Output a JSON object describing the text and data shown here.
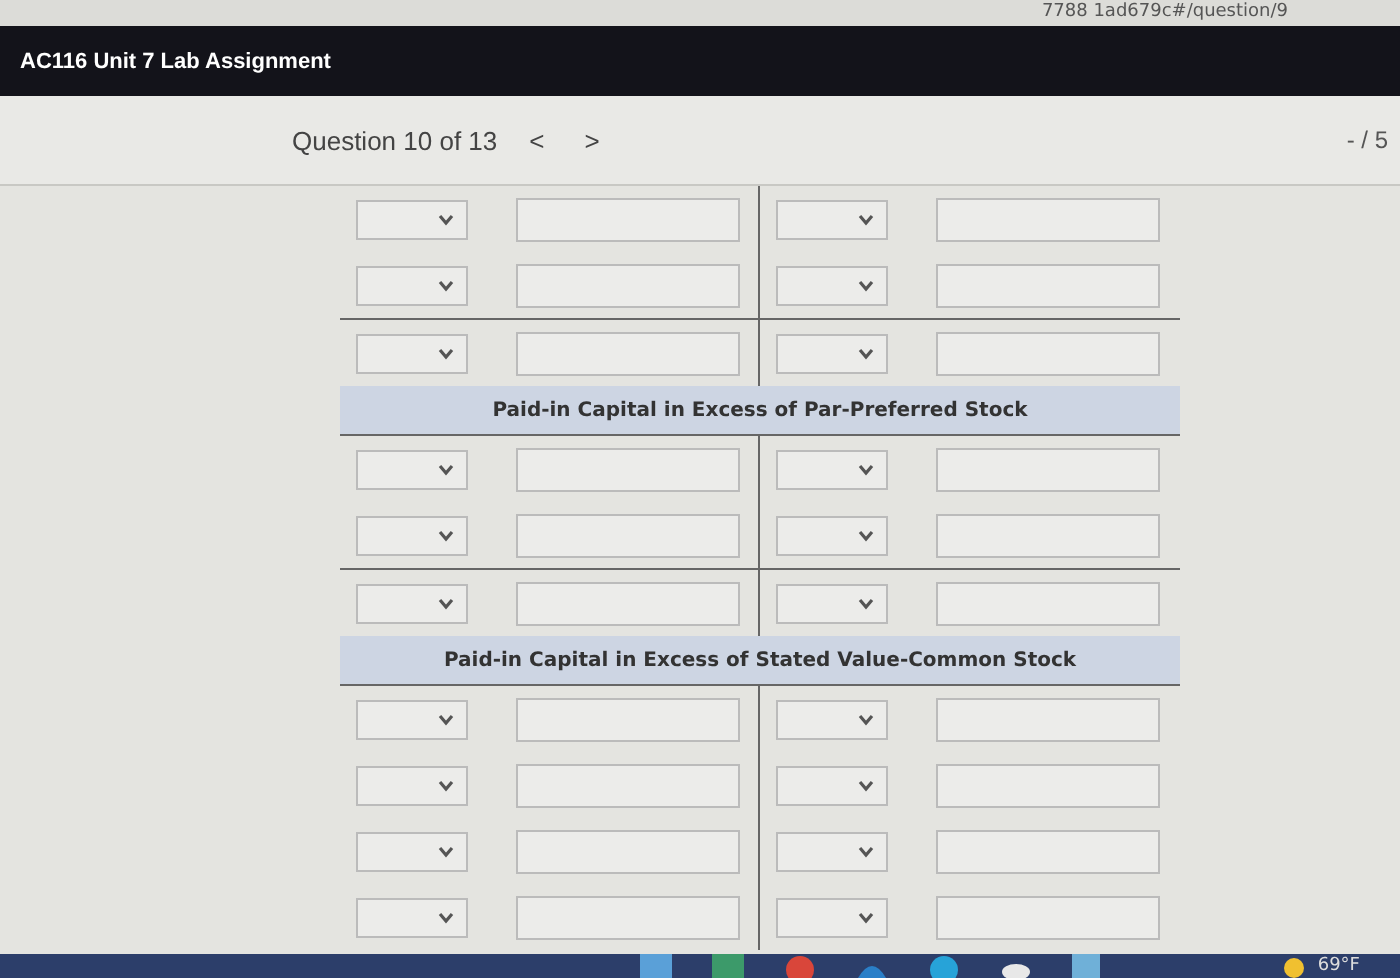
{
  "browser": {
    "url_fragment": "7788 1ad679c#/question/9"
  },
  "header": {
    "title": "AC116 Unit 7 Lab Assignment"
  },
  "question_bar": {
    "label": "Question 10 of 13",
    "prev": "<",
    "next": ">",
    "score": "- / 5"
  },
  "ledger": {
    "sections": [
      {
        "rows": [
          {
            "rule_below": false
          },
          {
            "rule_below": true
          },
          {
            "rule_below": false
          }
        ]
      },
      {
        "title": "Paid-in Capital in Excess of Par-Preferred Stock",
        "rows": [
          {
            "rule_below": false
          },
          {
            "rule_below": true
          },
          {
            "rule_below": false
          }
        ]
      },
      {
        "title": "Paid-in Capital in Excess of Stated Value-Common Stock",
        "rows": [
          {
            "rule_below": false
          },
          {
            "rule_below": false
          },
          {
            "rule_below": false
          },
          {
            "rule_below": false
          }
        ]
      }
    ]
  },
  "taskbar": {
    "weather": "69°F"
  }
}
